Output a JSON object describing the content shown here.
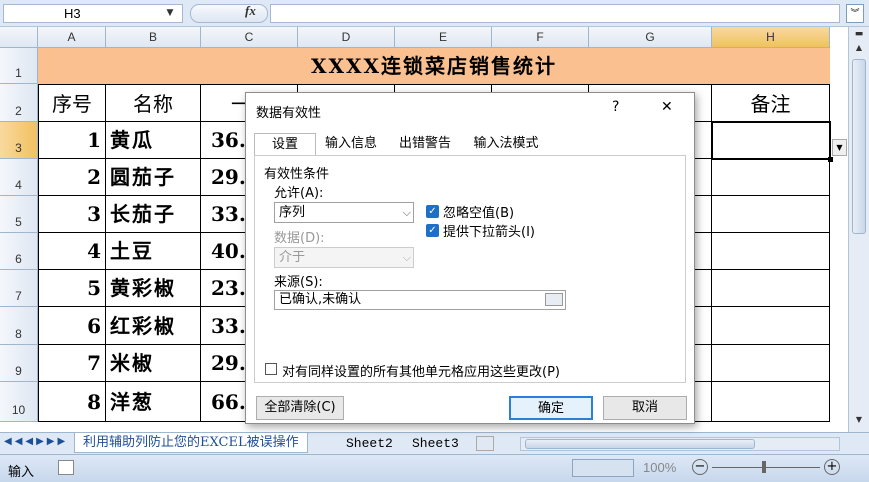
{
  "formula_bar": {
    "name_box": "H3",
    "fx": "fx"
  },
  "columns": [
    "A",
    "B",
    "C",
    "D",
    "E",
    "F",
    "G",
    "H"
  ],
  "rows": [
    "1",
    "2",
    "3",
    "4",
    "5",
    "6",
    "7",
    "8",
    "9",
    "10"
  ],
  "title": "XXXX连锁菜店销售统计",
  "headers": {
    "seq": "序号",
    "name": "名称",
    "c": "一",
    "notes": "备注"
  },
  "data_rows": [
    {
      "seq": "1",
      "name": "黄瓜",
      "c": "36."
    },
    {
      "seq": "2",
      "name": "圆茄子",
      "c": "29."
    },
    {
      "seq": "3",
      "name": "长茄子",
      "c": "33."
    },
    {
      "seq": "4",
      "name": "土豆",
      "c": "40."
    },
    {
      "seq": "5",
      "name": "黄彩椒",
      "c": "23."
    },
    {
      "seq": "6",
      "name": "红彩椒",
      "c": "33."
    },
    {
      "seq": "7",
      "name": "米椒",
      "c": "29."
    },
    {
      "seq": "8",
      "name": "洋葱",
      "c": "66."
    }
  ],
  "sheet_tabs": {
    "active": "利用辅助列防止您的EXCEL被误操作",
    "tab2": "Sheet2",
    "tab3": "Sheet3"
  },
  "status": {
    "mode": "输入",
    "zoom": "100%"
  },
  "dialog": {
    "title": "数据有效性",
    "help": "?",
    "close": "✕",
    "tabs": [
      "设置",
      "输入信息",
      "出错警告",
      "输入法模式"
    ],
    "criteria_label": "有效性条件",
    "allow_label": "允许(A):",
    "allow_value": "序列",
    "ignore_blank": "忽略空值(B)",
    "dropdown": "提供下拉箭头(I)",
    "data_label": "数据(D):",
    "data_value": "介于",
    "source_label": "来源(S):",
    "source_value": "已确认,未确认",
    "apply_all": "对有同样设置的所有其他单元格应用这些更改(P)",
    "clear_all": "全部清除(C)",
    "ok": "确定",
    "cancel": "取消"
  }
}
